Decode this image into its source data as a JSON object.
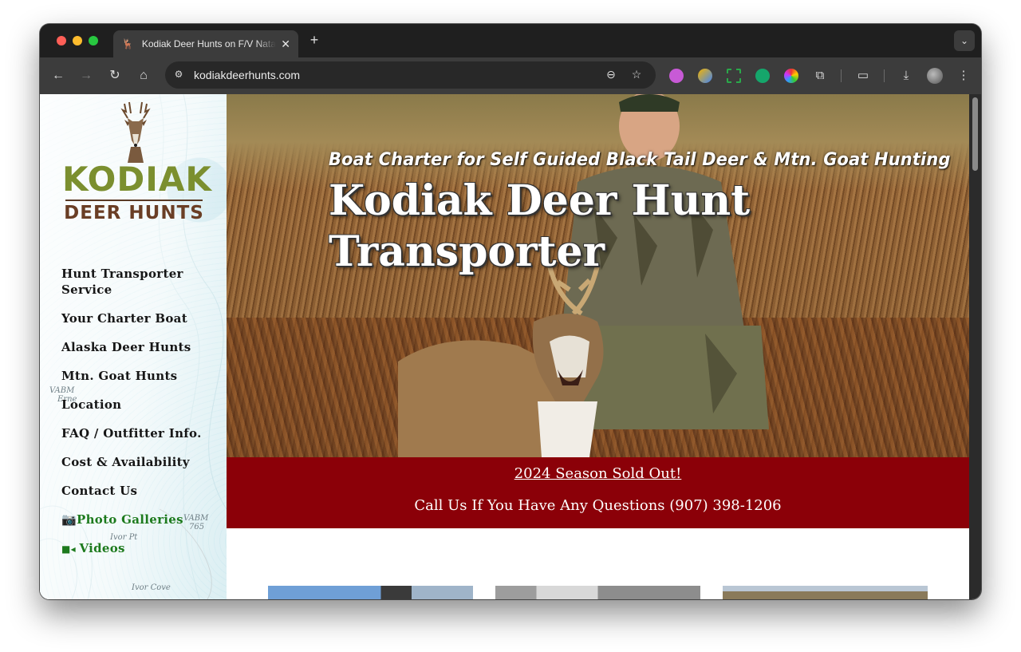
{
  "browser": {
    "tab_title": "Kodiak Deer Hunts on F/V Natalia",
    "url": "kodiakdeerhunts.com",
    "icons": [
      "back-icon",
      "forward-icon",
      "reload-icon",
      "home-icon",
      "site-info-icon",
      "zoom-icon",
      "bookmark-star-icon",
      "downloads-icon",
      "menu-icon",
      "cast-icon",
      "extensions-icon",
      "new-tab-icon",
      "tab-search-icon"
    ]
  },
  "logo": {
    "word": "KODIAK",
    "sub": "DEER HUNTS",
    "word_color": "#7b8f2f",
    "sub_color": "#6a3e25"
  },
  "map_labels": {
    "vabm_1": "VABM",
    "erne": "Erne",
    "vabm_2": "VABM",
    "vabm_2_height": "765",
    "ivor_pt": "Ivor Pt",
    "ivor_cove": "Ivor Cove"
  },
  "nav": {
    "items": [
      {
        "label": "Hunt Transporter Service"
      },
      {
        "label": "Your Charter Boat"
      },
      {
        "label": "Alaska Deer Hunts"
      },
      {
        "label": "Mtn. Goat Hunts"
      },
      {
        "label": "Location"
      },
      {
        "label": "FAQ / Outfitter Info."
      },
      {
        "label": "Cost & Availability"
      },
      {
        "label": "Contact Us"
      },
      {
        "label": "Photo Galleries",
        "icon": "camera-icon"
      },
      {
        "label": "Videos",
        "icon": "video-camera-icon"
      }
    ]
  },
  "hero": {
    "tagline": "Boat Charter for Self Guided Black Tail Deer & Mtn. Goat Hunting",
    "title": "Kodiak Deer Hunt Transporter"
  },
  "banner": {
    "sold_out": "2024 Season Sold Out!",
    "call": "Call Us If You Have Any Questions (907) 398-1206",
    "color": "#8b0008"
  }
}
